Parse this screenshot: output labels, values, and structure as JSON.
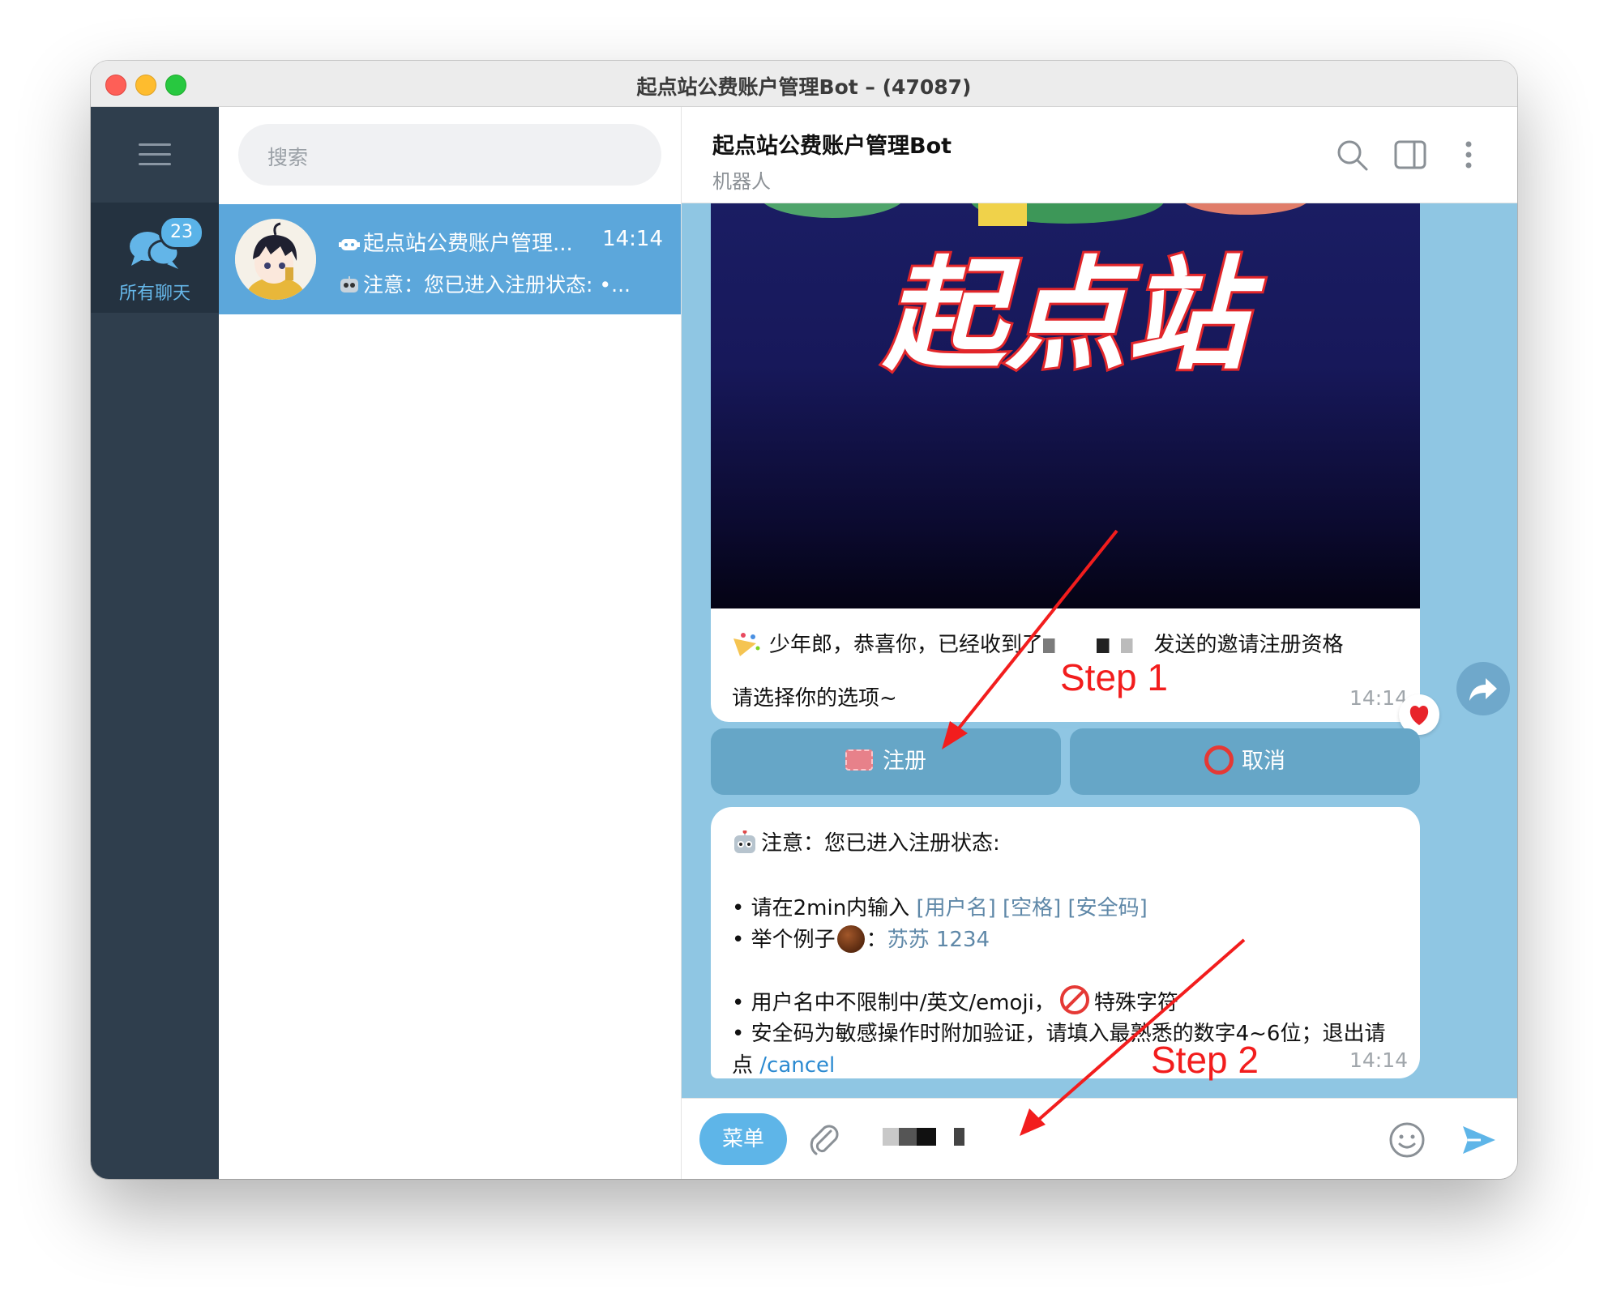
{
  "window": {
    "title": "起点站公费账户管理Bot – (47087)"
  },
  "sidebar": {
    "folder_label": "所有聊天",
    "unread_badge": "23"
  },
  "chat_list": {
    "search_placeholder": "搜索",
    "chats": [
      {
        "name": "起点站公费账户管理...",
        "time": "14:14",
        "preview": "注意：您已进入注册状态: •..."
      }
    ]
  },
  "header": {
    "title": "起点站公费账户管理Bot",
    "subtitle": "机器人"
  },
  "banner": {
    "logo_text": "起点站"
  },
  "messages": {
    "photo_caption": {
      "line1_start": "少年郎，恭喜你，已经收到了",
      "line1_end": "发送的邀请注册资格",
      "line2": "请选择你的选项~",
      "time": "14:14",
      "reaction": "heart"
    },
    "buttons": {
      "register": "注册",
      "cancel": "取消"
    },
    "notice": {
      "title": "注意：您已进入注册状态:",
      "bullet1_prefix": "• 请在2min内输入 ",
      "bullet1_fmt": "[用户名] [空格] [安全码]",
      "bullet2_prefix": "• 举个例子",
      "bullet2_colon": "：",
      "bullet2_example": "苏苏  1234",
      "bullet3_prefix": "• 用户名中不限制中/英文/emoji，",
      "bullet3_suffix": "特殊字符",
      "bullet4": "• 安全码为敏感操作时附加验证，请填入最熟悉的数字4~6位；退出请",
      "bullet4_cont": "点 ",
      "cancel_cmd": "/cancel",
      "time": "14:14"
    }
  },
  "composer": {
    "menu_label": "菜单"
  },
  "annotations": {
    "step1": "Step 1",
    "step2": "Step 2",
    "color": "#f21d1d"
  },
  "colors": {
    "accent": "#5ca7db",
    "rail": "#2f3e4d",
    "chat_bg": "#8fc6e3",
    "button": "#66a6c7"
  }
}
